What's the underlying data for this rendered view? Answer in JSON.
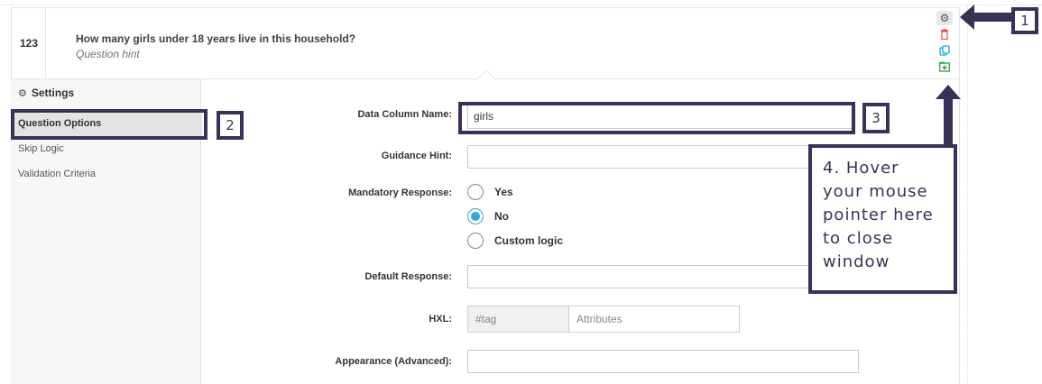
{
  "question": {
    "number": "123",
    "label": "How many girls under 18 years live in this household?",
    "hint": "Question hint"
  },
  "actions": {
    "settings_icon": "gear-icon",
    "delete_icon": "trash-icon",
    "duplicate_icon": "copy-icon",
    "add_icon": "add-to-library-icon"
  },
  "sidebar": {
    "title": "Settings",
    "items": [
      {
        "label": "Question Options",
        "active": true
      },
      {
        "label": "Skip Logic",
        "active": false
      },
      {
        "label": "Validation Criteria",
        "active": false
      }
    ]
  },
  "form": {
    "data_column_label": "Data Column Name:",
    "data_column_value": "girls",
    "guidance_label": "Guidance Hint:",
    "guidance_value": "",
    "mandatory_label": "Mandatory Response:",
    "mandatory_options": [
      {
        "label": "Yes",
        "selected": false
      },
      {
        "label": "No",
        "selected": true
      },
      {
        "label": "Custom logic",
        "selected": false
      }
    ],
    "default_label": "Default Response:",
    "default_value": "",
    "hxl_label": "HXL:",
    "hxl_tag_placeholder": "#tag",
    "hxl_attr_placeholder": "Attributes",
    "appearance_label": "Appearance (Advanced):",
    "appearance_value": ""
  },
  "annotations": {
    "n1": "1",
    "n2": "2",
    "n3": "3",
    "callout": "4. Hover your mouse pointer here to close window",
    "accent_color": "#3b3158"
  }
}
